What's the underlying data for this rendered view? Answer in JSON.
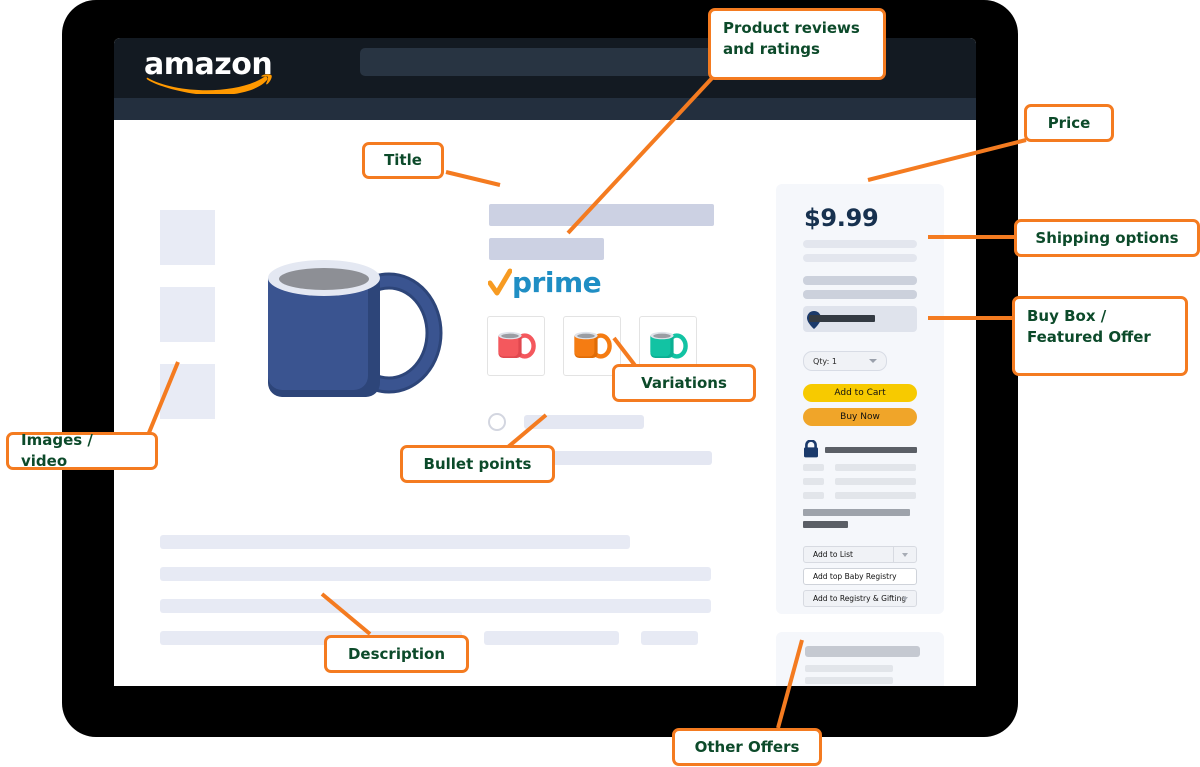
{
  "page": {
    "device": "tablet-mockup",
    "site_header": {
      "logo_text": "amazon",
      "search_placeholder": ""
    }
  },
  "product": {
    "price": "$9.99",
    "prime_badge": "prime",
    "title_placeholder_lines": 2,
    "variations": [
      {
        "name": "mug-red",
        "color": "#f4585d"
      },
      {
        "name": "mug-orange",
        "color": "#f57c12"
      },
      {
        "name": "mug-teal",
        "color": "#12c3a3"
      }
    ],
    "main_image": {
      "name": "coffee-mug",
      "body_color": "#2d4579",
      "rim_color": "#e4e8f2",
      "liquid_color": "#8d8f95"
    },
    "bullet_rows": 2,
    "thumbnails": 3,
    "description_lines": 4
  },
  "buybox": {
    "qty_label": "Qty: 1",
    "add_to_cart_label": "Add to Cart",
    "buy_now_label": "Buy Now",
    "add_to_list_label": "Add to List",
    "add_baby_registry_label": "Add top Baby Registry",
    "add_registry_gifting_label": "Add to Registry & Gifting",
    "colors": {
      "cart": "#f7ca00",
      "buy": "#f0a529",
      "panel": "#f5f7fb"
    }
  },
  "annotations": {
    "accent": "#f47b20",
    "text_color": "#0c4a2a",
    "items": [
      {
        "id": "reviews",
        "label": "Product reviews\nand ratings"
      },
      {
        "id": "title",
        "label": "Title"
      },
      {
        "id": "price",
        "label": "Price"
      },
      {
        "id": "shipping",
        "label": "Shipping options"
      },
      {
        "id": "buybox",
        "label": "Buy Box /\nFeatured Offer"
      },
      {
        "id": "variations",
        "label": "Variations"
      },
      {
        "id": "bullets",
        "label": "Bullet points"
      },
      {
        "id": "images",
        "label": "Images / video"
      },
      {
        "id": "description",
        "label": "Description"
      },
      {
        "id": "offers",
        "label": "Other Offers"
      }
    ]
  }
}
